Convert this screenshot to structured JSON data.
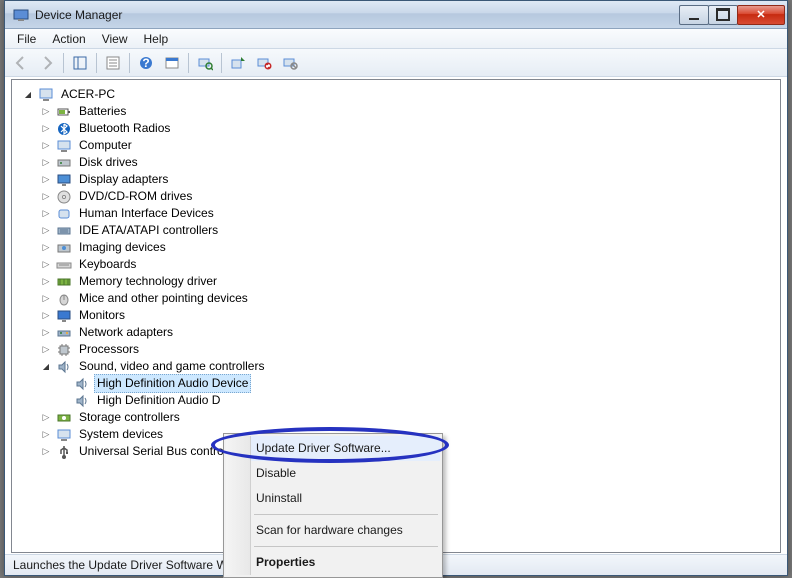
{
  "window": {
    "title": "Device Manager"
  },
  "menu": {
    "items": [
      "File",
      "Action",
      "View",
      "Help"
    ]
  },
  "tree": {
    "root": "ACER-PC",
    "categories": [
      "Batteries",
      "Bluetooth Radios",
      "Computer",
      "Disk drives",
      "Display adapters",
      "DVD/CD-ROM drives",
      "Human Interface Devices",
      "IDE ATA/ATAPI controllers",
      "Imaging devices",
      "Keyboards",
      "Memory technology driver",
      "Mice and other pointing devices",
      "Monitors",
      "Network adapters",
      "Processors"
    ],
    "sound_category": "Sound, video and game controllers",
    "sound_children": [
      "High Definition Audio Device",
      "High Definition Audio D"
    ],
    "tail_categories": [
      "Storage controllers",
      "System devices",
      "Universal Serial Bus controll"
    ]
  },
  "context_menu": {
    "items": {
      "update": "Update Driver Software...",
      "disable": "Disable",
      "uninstall": "Uninstall",
      "scan": "Scan for hardware changes",
      "properties": "Properties"
    }
  },
  "statusbar": {
    "text": "Launches the Update Driver Software Wizard for the selected device."
  }
}
